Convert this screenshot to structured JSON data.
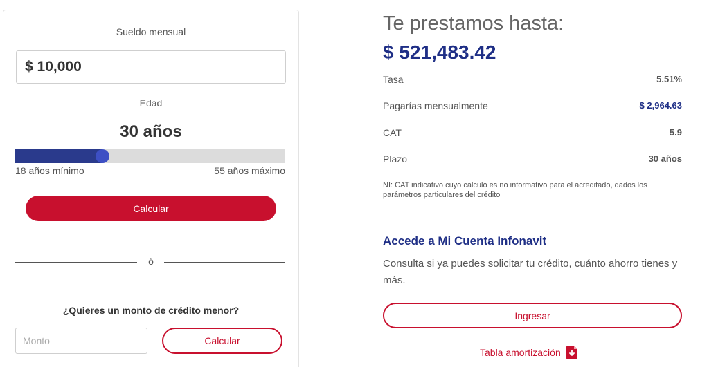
{
  "calculator": {
    "salary_label": "Sueldo mensual",
    "salary_value": "$ 10,000",
    "age_label": "Edad",
    "age_value": "30 años",
    "age_slider": {
      "min": 18,
      "max": 55,
      "value": 30,
      "fill_color": "#2a3a8c",
      "thumb_color": "#3d4fc4"
    },
    "age_min_label": "18 años mínimo",
    "age_max_label": "55 años máximo",
    "calculate_label": "Calcular",
    "divider_text": "ó",
    "lower_amount_question": "¿Quieres un monto de crédito menor?",
    "amount_placeholder": "Monto",
    "amount_calculate_label": "Calcular"
  },
  "result": {
    "headline": "Te prestamos hasta:",
    "amount": "$ 521,483.42",
    "rows": [
      {
        "label": "Tasa",
        "value": "5.51%"
      },
      {
        "label": "Pagarías mensualmente",
        "value": "$ 2,964.63"
      },
      {
        "label": "CAT",
        "value": "5.9"
      },
      {
        "label": "Plazo",
        "value": "30 años"
      }
    ],
    "note": "NI: CAT indicativo cuyo cálculo es no informativo para el acreditado, dados los parámetros particulares del crédito"
  },
  "account": {
    "title": "Accede a Mi Cuenta Infonavit",
    "description": "Consulta si ya puedes solicitar tu crédito, cuánto ahorro tienes y más.",
    "login_label": "Ingresar",
    "amortization_link": "Tabla amortización",
    "amortization_icon": "pdf-download-icon"
  },
  "colors": {
    "brand_red": "#c8102e",
    "brand_blue": "#1f2f86"
  }
}
